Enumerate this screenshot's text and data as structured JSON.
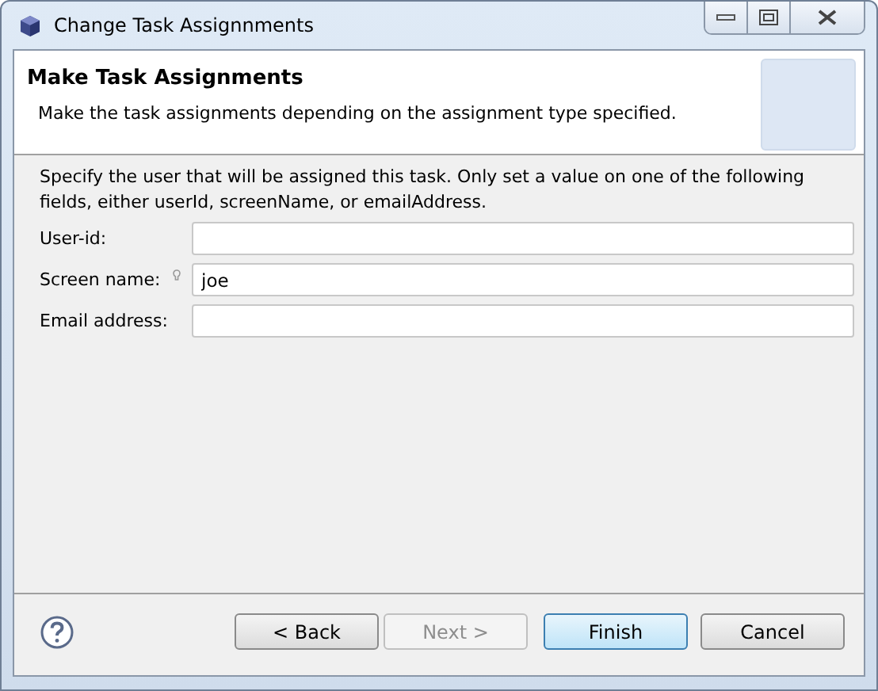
{
  "window": {
    "title": "Change Task Assignnments"
  },
  "header": {
    "title": "Make Task Assignments",
    "description": "Make the task assignments depending on the assignment type specified."
  },
  "instructions": "Specify the user that will be assigned this task. Only set a value on one of the following fields, either userId, screenName, or emailAddress.",
  "fields": [
    {
      "label": "User-id:",
      "decorated": false
    },
    {
      "label": "Screen name:",
      "value": "joe",
      "decorated": true
    },
    {
      "label": "Email address:",
      "decorated": false
    }
  ],
  "buttons": [
    {
      "label": "< Back",
      "disabled": false,
      "default": false
    },
    {
      "label": "Next >",
      "disabled": true,
      "default": false
    },
    {
      "label": "Finish",
      "disabled": false,
      "default": true
    },
    {
      "label": "Cancel",
      "disabled": false,
      "default": false
    }
  ]
}
